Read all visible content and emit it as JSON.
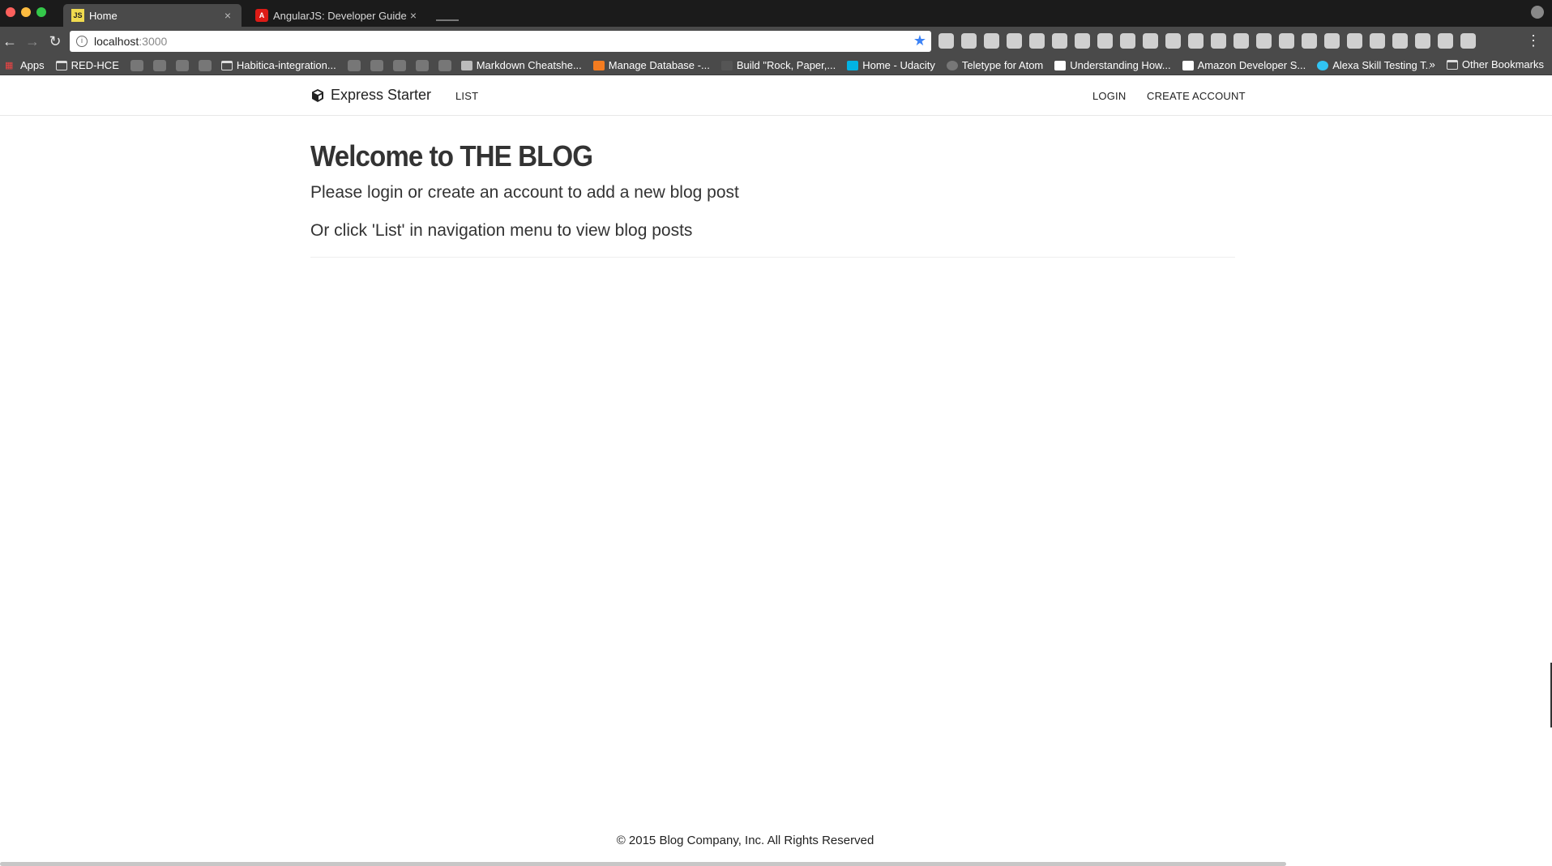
{
  "browser": {
    "tabs": [
      {
        "title": "Home",
        "favicon": "js-icon",
        "active": true
      },
      {
        "title": "AngularJS: Developer Guide: F",
        "favicon": "angular-icon",
        "active": false
      }
    ],
    "url": {
      "host": "localhost",
      "port": ":3000"
    },
    "bookmarks": [
      {
        "label": "Apps",
        "icon": "apps-grid-icon"
      },
      {
        "label": "RED-HCE",
        "icon": "folder-icon"
      },
      {
        "label": "Habitica-integration...",
        "icon": "folder-icon"
      },
      {
        "label": "Markdown Cheatshe...",
        "icon": "github-icon"
      },
      {
        "label": "Manage Database -...",
        "icon": "database-icon"
      },
      {
        "label": "Build \"Rock, Paper,...",
        "icon": "page-icon"
      },
      {
        "label": "Home - Udacity",
        "icon": "udacity-icon"
      },
      {
        "label": "Teletype for Atom",
        "icon": "atom-icon"
      },
      {
        "label": "Understanding How...",
        "icon": "amazon-icon"
      },
      {
        "label": "Amazon Developer S...",
        "icon": "amazon-icon"
      },
      {
        "label": "Alexa Skill Testing T...",
        "icon": "alexa-icon"
      }
    ],
    "bookmarks_overflow": "»",
    "other_bookmarks": "Other Bookmarks",
    "tab_close": "×"
  },
  "site": {
    "brand": "Express Starter",
    "nav": {
      "list": "LIST",
      "login": "LOGIN",
      "create_account": "CREATE ACCOUNT"
    },
    "heading": "Welcome to THE BLOG",
    "line1": "Please login or create an account to add a new blog post",
    "line2": "Or click 'List' in navigation menu to view blog posts",
    "footer": "© 2015 Blog Company, Inc. All Rights Reserved"
  }
}
